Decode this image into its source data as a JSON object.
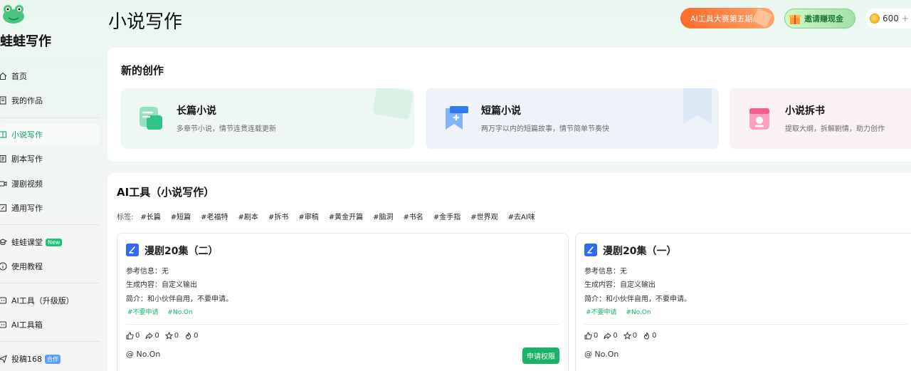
{
  "sidebar": {
    "brand": "蛙蛙写作",
    "items": [
      {
        "label": "首页",
        "icon": "home-icon"
      },
      {
        "label": "我的作品",
        "icon": "document-icon"
      },
      {
        "label": "小说写作",
        "icon": "book-icon",
        "active": true
      },
      {
        "label": "剧本写作",
        "icon": "script-icon"
      },
      {
        "label": "漫剧视频",
        "icon": "video-icon"
      },
      {
        "label": "通用写作",
        "icon": "pen-icon"
      },
      {
        "label": "蛙蛙课堂",
        "icon": "graduation-icon",
        "badge": "New"
      },
      {
        "label": "使用教程",
        "icon": "info-icon"
      },
      {
        "label": "AI工具（升级版）",
        "icon": "ai-icon"
      },
      {
        "label": "AI工具箱",
        "icon": "ai-icon"
      },
      {
        "label": "投稿168",
        "icon": "send-icon",
        "badge": "合作"
      }
    ]
  },
  "header": {
    "title": "小说写作",
    "promo_label": "AI工具大赛第五期",
    "invite_label": "邀请赚现金",
    "coins": "600"
  },
  "new_creation": {
    "title": "新的创作",
    "cards": [
      {
        "title": "长篇小说",
        "desc": "多章节小说，情节连贯连载更新",
        "bg": "#eef7f3",
        "icon": "long-novel-icon"
      },
      {
        "title": "短篇小说",
        "desc": "两万字以内的短篇故事，情节简单节奏快",
        "bg": "#eef3fa",
        "icon": "short-novel-icon"
      },
      {
        "title": "小说拆书",
        "desc": "提取大纲，拆解剧情，助力创作",
        "bg": "#faf1f4",
        "icon": "book-split-icon"
      }
    ]
  },
  "ai_tools": {
    "title": "AI工具（小说写作）",
    "tags_label": "标签:",
    "tags": [
      "#长篇",
      "#短篇",
      "#老福特",
      "#剧本",
      "#拆书",
      "#审稿",
      "#黄金开篇",
      "#脑洞",
      "#书名",
      "#金手指",
      "#世界观",
      "#去AI味"
    ],
    "cards": [
      {
        "title": "漫剧20集（二）",
        "ref": "参考信息：无",
        "output": "生成内容：自定义输出",
        "intro": "简介：和小伙伴自用，不要申请。",
        "tags": [
          "#不要申请",
          "#No.On"
        ],
        "likes": "0",
        "shares": "0",
        "stars": "0",
        "hots": "0",
        "author": "@ No.On",
        "button": "申请权限"
      },
      {
        "title": "漫剧20集（一）",
        "ref": "参考信息：无",
        "output": "生成内容：自定义输出",
        "intro": "简介：和小伙伴自用，不要申请。",
        "tags": [
          "#不要申请",
          "#No.On"
        ],
        "likes": "0",
        "shares": "0",
        "stars": "0",
        "hots": "0",
        "author": "@ No.On"
      }
    ]
  },
  "colors": {
    "accent": "#19b366",
    "promo": "#ff6a2b",
    "card_icon": "#2f6bf0"
  }
}
